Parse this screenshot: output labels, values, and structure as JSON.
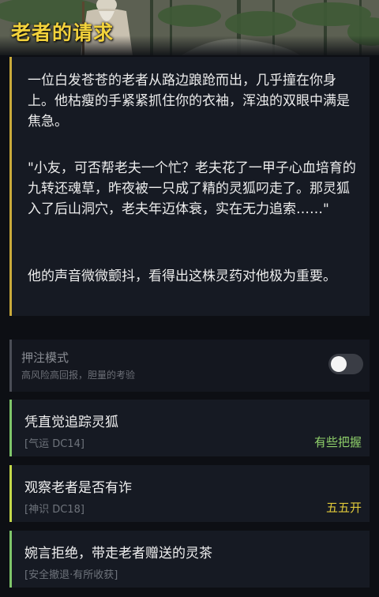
{
  "header": {
    "title": "老者的请求"
  },
  "story": {
    "paragraphs": [
      "一位白发苍苍的老者从路边踉跄而出，几乎撞在你身上。他枯瘦的手紧紧抓住你的衣袖，浑浊的双眼中满是焦急。",
      "\"小友，可否帮老夫一个忙？老夫花了一甲子心血培育的九转还魂草，昨夜被一只成了精的灵狐叼走了。那灵狐入了后山洞穴，老夫年迈体衰，实在无力追索……\"",
      "他的声音微微颤抖，看得出这株灵药对他极为重要。"
    ]
  },
  "bet_mode": {
    "label": "押注模式",
    "sublabel": "高风险高回报，胆量的考验",
    "enabled": false
  },
  "choices": [
    {
      "label": "凭直觉追踪灵狐",
      "check": "[气运 DC14]",
      "odds": "有些把握",
      "odds_color": "#8fd06a"
    },
    {
      "label": "观察老者是否有诈",
      "check": "[神识 DC18]",
      "odds": "五五开",
      "odds_color": "#e0c93a"
    },
    {
      "label": "婉言拒绝，带走老者赠送的灵茶",
      "check": "[安全撤退·有所收获]",
      "odds": "",
      "odds_color": "#8fd06a"
    }
  ],
  "colors": {
    "title": "#f2d23c",
    "story_accent": "#c9a93a",
    "background": "#0d0f14",
    "card": "#161a23"
  }
}
